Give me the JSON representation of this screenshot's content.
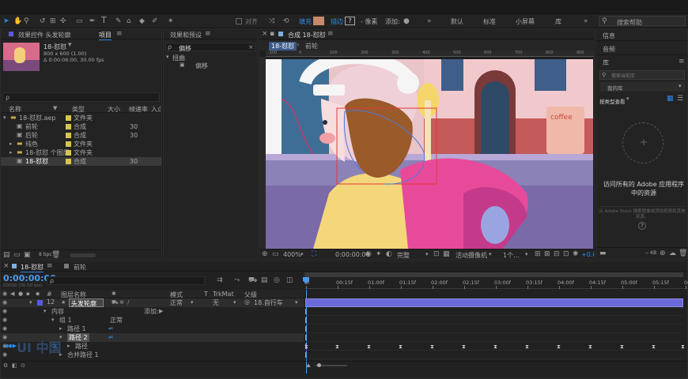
{
  "toolbar": {
    "align_label": "对齐",
    "fill_label": "填充",
    "stroke_label": "描边",
    "stroke_help": "?",
    "px_label": "- 像素",
    "add_label": "添加:",
    "workspaces": [
      "默认",
      "标准",
      "小屏幕",
      "库"
    ],
    "search_placeholder": "搜索帮助",
    "fill_color": "#c58a6a"
  },
  "project_panel": {
    "tab_effects": "效果控件 头发轮廓",
    "tab_project": "项目",
    "thumb_name": "18-怼怼",
    "thumb_info1": "800 x 600 (1.00)",
    "thumb_info2": "Δ 0:00:06:00, 30.00 fps",
    "search_icon": "ρ",
    "columns": [
      "名称",
      "类型",
      "大小",
      "帧速率",
      "入点"
    ],
    "rows": [
      {
        "name": "18-怼怼.aep",
        "type": "文件夹",
        "size": "",
        "fps": "",
        "color": "#d8c44a",
        "indent": 0,
        "kind": "folder"
      },
      {
        "name": "前轮",
        "type": "合成",
        "size": "",
        "fps": "30",
        "color": "#d8c44a",
        "indent": 1,
        "kind": "comp"
      },
      {
        "name": "后轮",
        "type": "合成",
        "size": "",
        "fps": "30",
        "color": "#d8c44a",
        "indent": 1,
        "kind": "comp"
      },
      {
        "name": "纯色",
        "type": "文件夹",
        "size": "",
        "fps": "",
        "color": "#d8c44a",
        "indent": 1,
        "kind": "folder"
      },
      {
        "name": "18-怼怼 个图层",
        "type": "文件夹",
        "size": "",
        "fps": "",
        "color": "#d8c44a",
        "indent": 1,
        "kind": "folder"
      },
      {
        "name": "18-怼怼",
        "type": "合成",
        "size": "",
        "fps": "30",
        "color": "#d8c44a",
        "indent": 1,
        "kind": "comp",
        "selected": true
      }
    ],
    "bpc": "8 bpc"
  },
  "effects_panel": {
    "title": "效果和预设",
    "search_value": "偏移",
    "category": "扭曲",
    "item": "偏移"
  },
  "comp_panel": {
    "title": "合成 18-怼怼",
    "tab_active": "18-怼怼",
    "tab_other": "前轮",
    "ruler_labels": [
      "-100",
      "0",
      "100",
      "200",
      "300",
      "400",
      "500",
      "600",
      "700",
      "800",
      "900"
    ],
    "zoom": "400%",
    "timecode": "0:00:00:00",
    "quality": "完整",
    "camera": "活动摄像机",
    "views": "1个...",
    "exposure": "+0.0",
    "sign_text": "coffee"
  },
  "right_panel": {
    "info_title": "信息",
    "audio_title": "音频",
    "library_title": "库",
    "lib_search_placeholder": "搜索当前库",
    "lib_dropdown": "我的库",
    "group_by": "按类型查看",
    "access_text": "访问所有的 Adobe 应用程序中的资源",
    "stock_text": "从 Adobe Stock 搜索图像或添加视频和其他资源。",
    "kb_label": "-- KB"
  },
  "timeline": {
    "tab_active": "18-怼怼",
    "tab_other": "前轮",
    "timecode": "0:00:00:00",
    "timecode_sub": "00000 (30.00 fps)",
    "search_icon": "ρ",
    "header_cols": [
      "图层名称",
      "模式",
      "T",
      "TrkMat",
      "父级"
    ],
    "ruler_labels": [
      "0f",
      "00:15f",
      "01:00f",
      "01:15f",
      "02:00f",
      "02:15f",
      "03:00f",
      "03:15f",
      "04:00f",
      "04:15f",
      "05:00f",
      "05:15f",
      "06:0"
    ],
    "layer": {
      "num": "12",
      "name": "头发轮廓",
      "mode": "正常",
      "trkmat": "无",
      "parent": "18.自行车"
    },
    "props": [
      {
        "label": "内容",
        "extra": "添加:",
        "indent": 1
      },
      {
        "label": "组 1",
        "extra": "正常",
        "indent": 2
      },
      {
        "label": "路径 1",
        "extra": "",
        "indent": 3
      },
      {
        "label": "路径 2",
        "extra": "",
        "indent": 3
      },
      {
        "label": "路径",
        "extra": "",
        "indent": 4
      },
      {
        "label": "合并路径 1",
        "extra": "",
        "indent": 3
      }
    ],
    "keyframes": [
      "386",
      "425",
      "465",
      "505",
      "545",
      "585",
      "625",
      "665",
      "705",
      "745",
      "785",
      "825",
      "862"
    ],
    "watermark": "UI 中国"
  }
}
